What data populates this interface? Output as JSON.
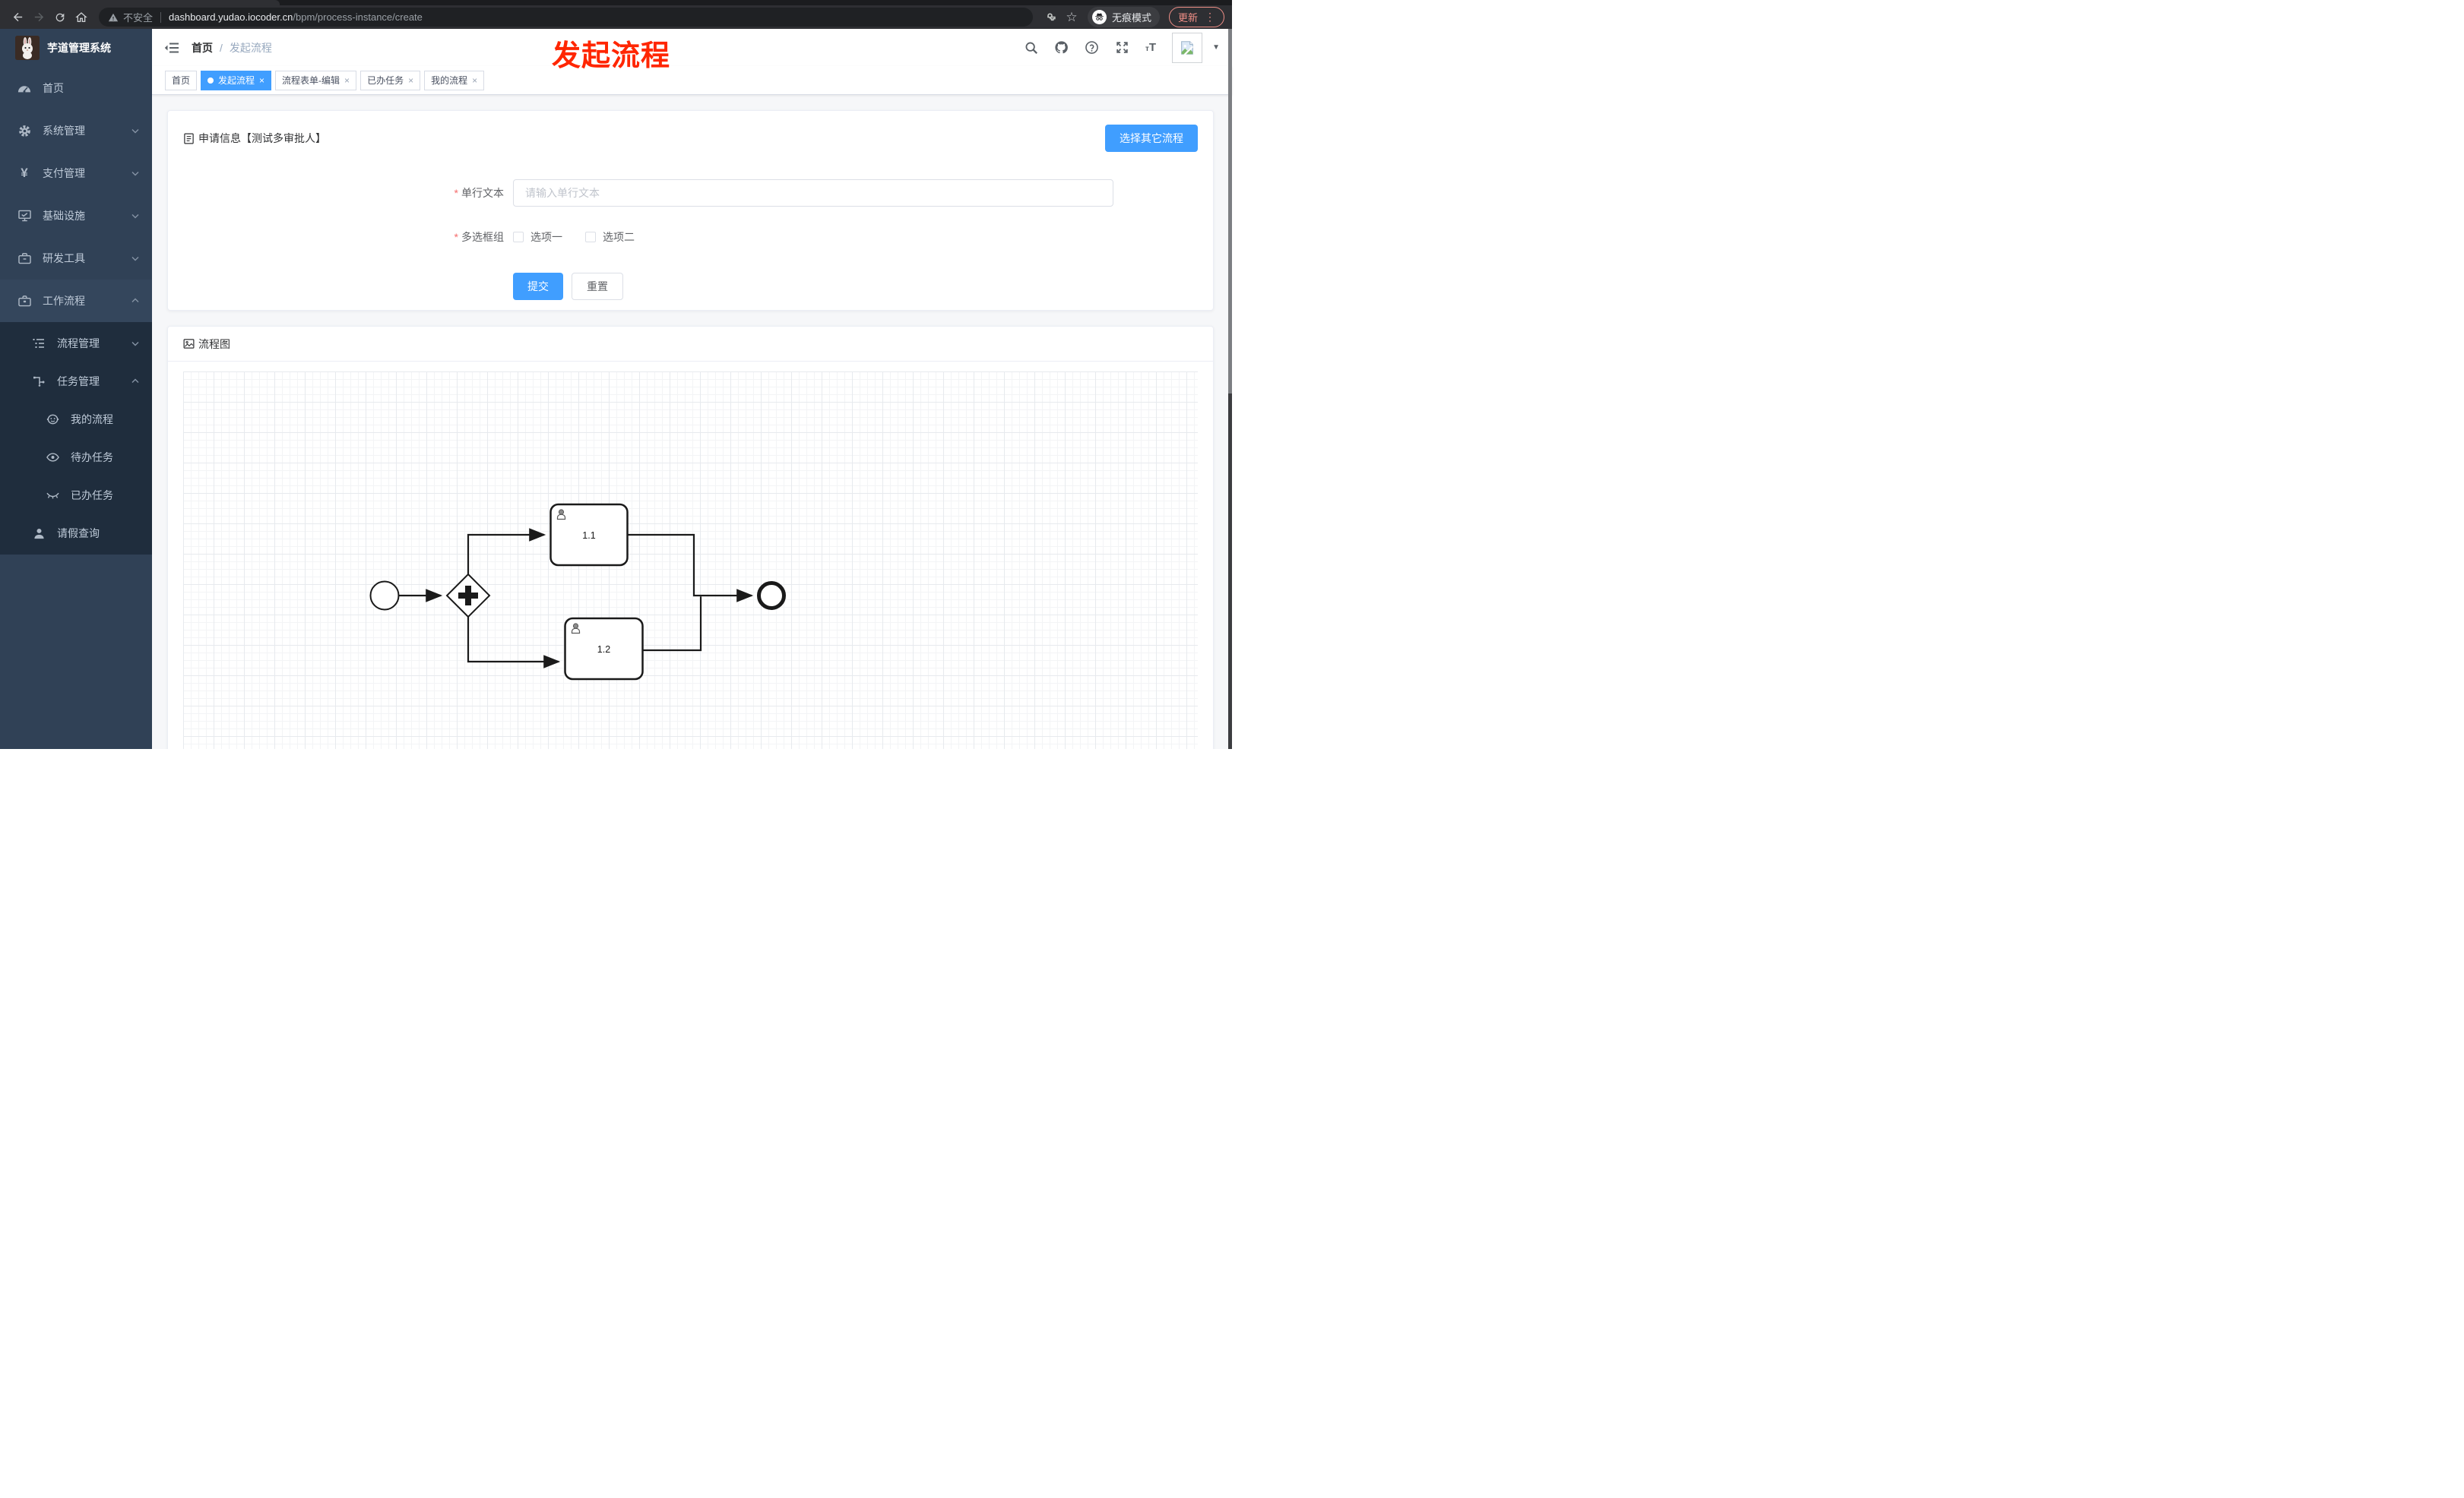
{
  "browser": {
    "security_label": "不安全",
    "url_host": "dashboard.yudao.iocoder.cn",
    "url_path": "/bpm/process-instance/create",
    "incognito_label": "无痕模式",
    "update_label": "更新"
  },
  "icons": {
    "star": "☆",
    "dots": "⋮",
    "caret": "▼",
    "close": "×",
    "yen": "¥",
    "text_size_small": "т",
    "text_size_big": "T"
  },
  "annotation": {
    "title": "发起流程",
    "color": "#ff2600"
  },
  "sidebar": {
    "title": "芋道管理系统",
    "items": [
      {
        "label": "首页",
        "icon": "dashboard-icon",
        "chevron": "none"
      },
      {
        "label": "系统管理",
        "icon": "gear-icon",
        "chevron": "down"
      },
      {
        "label": "支付管理",
        "icon": "yen-icon",
        "chevron": "down"
      },
      {
        "label": "基础设施",
        "icon": "monitor-icon",
        "chevron": "down"
      },
      {
        "label": "研发工具",
        "icon": "briefcase-icon",
        "chevron": "down"
      },
      {
        "label": "工作流程",
        "icon": "toolbox-icon",
        "chevron": "up"
      }
    ],
    "submenu": [
      {
        "label": "流程管理",
        "icon": "tree-icon",
        "chevron": "down",
        "level": 2
      },
      {
        "label": "任务管理",
        "icon": "flow-icon",
        "chevron": "up",
        "level": 2
      },
      {
        "label": "我的流程",
        "icon": "face-icon",
        "level": 3
      },
      {
        "label": "待办任务",
        "icon": "eye-open-icon",
        "level": 3
      },
      {
        "label": "已办任务",
        "icon": "eye-closed-icon",
        "level": 3
      },
      {
        "label": "请假查询",
        "icon": "user-icon",
        "level": 2
      }
    ]
  },
  "header": {
    "breadcrumb": [
      "首页",
      "发起流程"
    ]
  },
  "tabs": [
    {
      "label": "首页",
      "active": false,
      "closable": false
    },
    {
      "label": "发起流程",
      "active": true,
      "closable": true
    },
    {
      "label": "流程表单-编辑",
      "active": false,
      "closable": true
    },
    {
      "label": "已办任务",
      "active": false,
      "closable": true
    },
    {
      "label": "我的流程",
      "active": false,
      "closable": true
    }
  ],
  "form_card": {
    "title": "申请信息【测试多审批人】",
    "choose_other_button": "选择其它流程",
    "required_mark": "*",
    "fields": [
      {
        "label": "单行文本",
        "required": true,
        "type": "input",
        "value": "",
        "placeholder": "请输入单行文本"
      },
      {
        "label": "多选框组",
        "required": true,
        "type": "checkbox-group",
        "options": [
          {
            "label": "选项一",
            "checked": false
          },
          {
            "label": "选项二",
            "checked": false
          }
        ]
      }
    ],
    "submit_label": "提交",
    "reset_label": "重置"
  },
  "diagram_card": {
    "title": "流程图",
    "type": "bpmn-viewer",
    "nodes": {
      "start": {
        "kind": "start-event"
      },
      "gateway": {
        "kind": "parallel-gateway"
      },
      "task1": {
        "kind": "user-task",
        "label": "1.1"
      },
      "task2": {
        "kind": "user-task",
        "label": "1.2"
      },
      "end": {
        "kind": "end-event"
      }
    },
    "flows": [
      "start→gateway",
      "gateway→task1.1",
      "gateway→task1.2",
      "task1.1→end",
      "task1.2→end"
    ]
  },
  "colors": {
    "accent_blue": "#409eff",
    "sidebar_bg": "#304156",
    "submenu_bg": "#1f2d3d",
    "annotation_red": "#ff2600",
    "update_red": "#ef8e86",
    "required_red": "#f56c6c"
  }
}
